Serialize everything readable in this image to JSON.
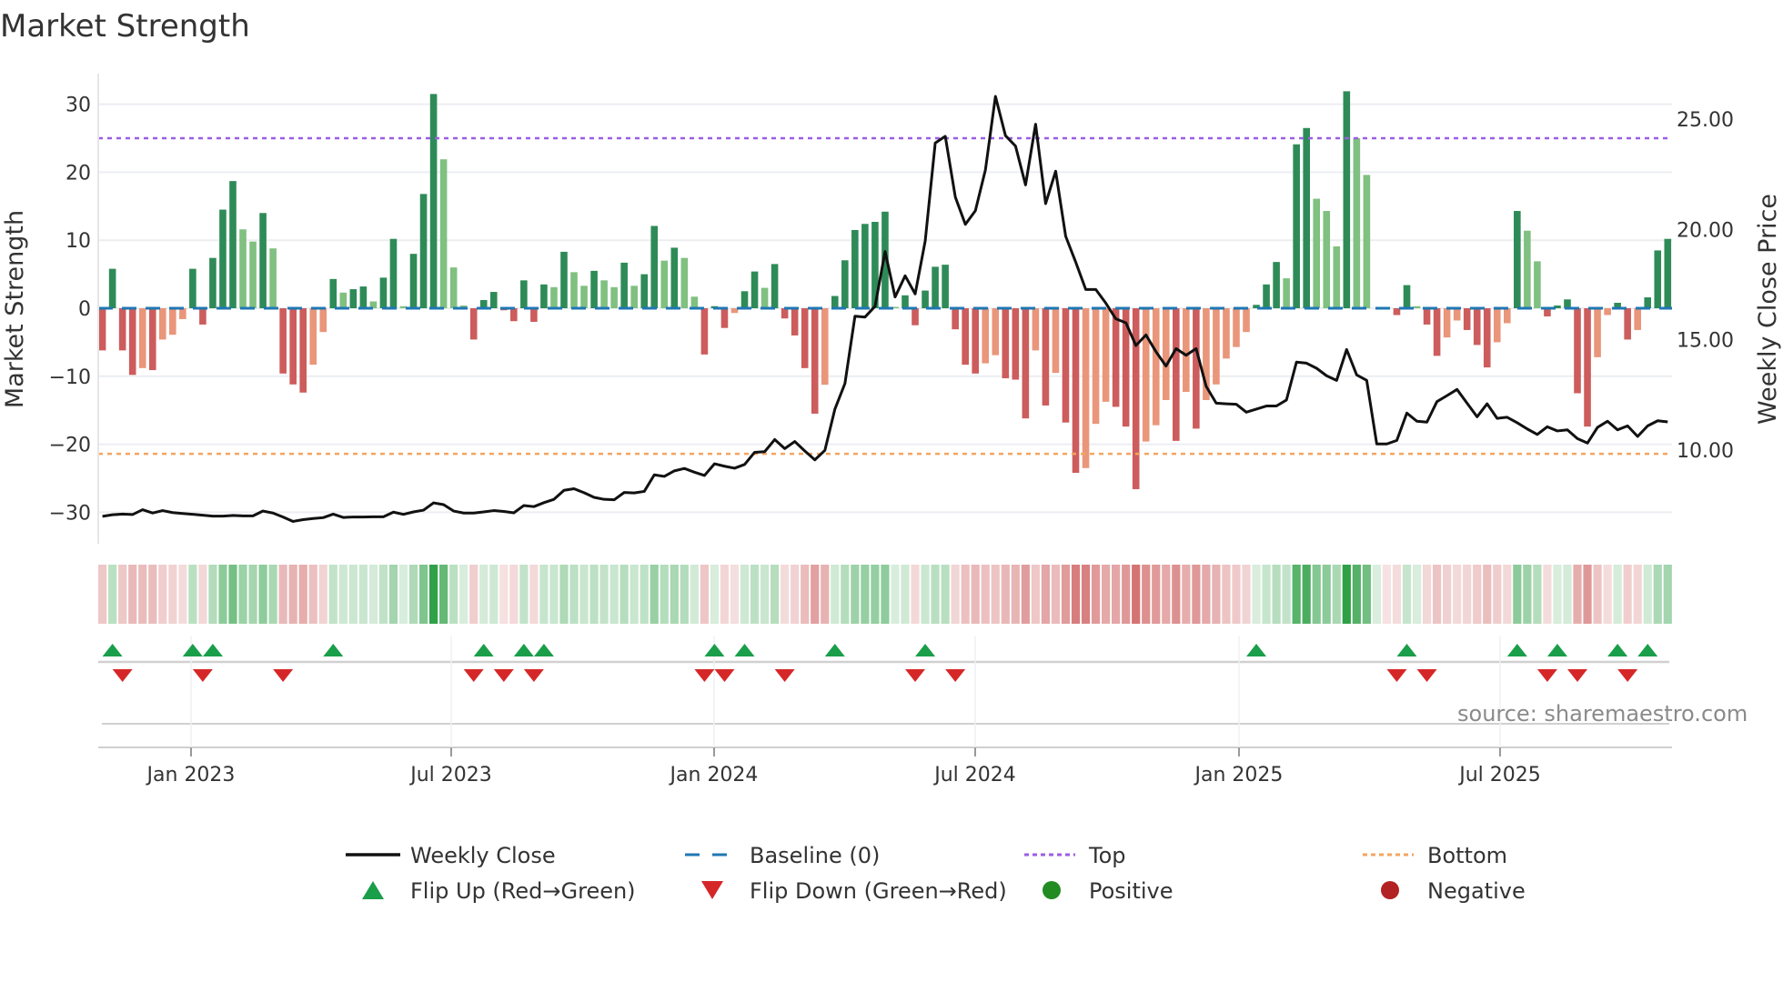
{
  "chart_data": {
    "type": "bar",
    "title": "Market Strength",
    "ylabel": "Market Strength",
    "y2label": "Weekly Close Price",
    "ylim": [
      -34,
      33
    ],
    "y2lim": [
      5.58,
      26.87
    ],
    "yticks": [
      30,
      20,
      10,
      0,
      -10,
      -20,
      -30
    ],
    "yticklabels": [
      "30",
      "20",
      "10",
      "0",
      "−10",
      "−20",
      "−30"
    ],
    "y2ticks": [
      25,
      20,
      15,
      10
    ],
    "y2ticklabels": [
      "25.00",
      "20.00",
      "15.00",
      "10.00"
    ],
    "xticks": [
      {
        "label": "Jan 2023",
        "week": 8.83
      },
      {
        "label": "Jul 2023",
        "week": 34.76
      },
      {
        "label": "Jan 2024",
        "week": 60.96
      },
      {
        "label": "Jul 2024",
        "week": 86.98
      },
      {
        "label": "Jan 2025",
        "week": 113.27
      },
      {
        "label": "Jul 2025",
        "week": 139.29
      }
    ],
    "grid": true,
    "legend_placement": "bottom",
    "top_level": 25,
    "bottom_level": -21.4,
    "baseline": 0,
    "strength": [
      -6.2,
      5.8,
      -6.2,
      -9.8,
      -8.8,
      -9.1,
      -4.6,
      -3.9,
      -1.6,
      5.8,
      -2.4,
      7.4,
      14.5,
      18.7,
      11.6,
      9.8,
      14.0,
      8.8,
      -9.6,
      -11.2,
      -12.4,
      -8.3,
      -3.5,
      4.3,
      2.3,
      2.8,
      3.2,
      1.0,
      4.5,
      10.2,
      0.3,
      8.0,
      16.8,
      31.5,
      21.9,
      6.0,
      0.4,
      -4.6,
      1.2,
      2.4,
      -0.3,
      -1.9,
      4.1,
      -2.0,
      3.5,
      3.1,
      8.3,
      5.3,
      3.3,
      5.5,
      4.1,
      3.1,
      6.7,
      3.3,
      5.0,
      12.1,
      7.0,
      8.9,
      7.4,
      1.7,
      -6.8,
      0.3,
      -2.9,
      -0.7,
      2.5,
      5.4,
      3.0,
      6.5,
      -1.5,
      -4.0,
      -8.8,
      -15.5,
      -11.25,
      1.8,
      7.05,
      11.5,
      12.4,
      12.7,
      14.2,
      0.2,
      1.9,
      -2.5,
      2.6,
      6.1,
      6.4,
      -3.1,
      -8.3,
      -9.6,
      -8.1,
      -6.9,
      -10.3,
      -10.5,
      -16.2,
      -6.2,
      -14.3,
      -9.5,
      -16.8,
      -24.2,
      -23.5,
      -17.0,
      -13.75,
      -14.5,
      -17.4,
      -26.6,
      -19.6,
      -17.2,
      -13.5,
      -19.5,
      -12.3,
      -17.7,
      -13.5,
      -11.2,
      -7.4,
      -5.7,
      -3.5,
      0.5,
      3.5,
      6.8,
      4.4,
      24.1,
      26.5,
      16.1,
      14.3,
      9.1,
      31.9,
      25.0,
      19.6,
      0,
      0,
      -1.0,
      3.4,
      0.3,
      -2.4,
      -7.0,
      -4.3,
      -1.8,
      -3.2,
      -5.4,
      -8.7,
      -5.0,
      -2.2,
      14.3,
      11.4,
      6.9,
      -1.2,
      0.4,
      1.3,
      -12.5,
      -17.4,
      -7.2,
      -1.0,
      0.8,
      -4.6,
      -3.2,
      1.6,
      8.5,
      10.2
    ],
    "weekly_close": [
      7.0,
      7.07,
      7.1,
      7.08,
      7.3,
      7.15,
      7.26,
      7.17,
      7.13,
      7.09,
      7.05,
      7.01,
      7.01,
      7.04,
      7.02,
      7.02,
      7.24,
      7.15,
      6.97,
      6.77,
      6.85,
      6.9,
      6.94,
      7.1,
      6.95,
      6.97,
      6.97,
      6.98,
      6.98,
      7.19,
      7.09,
      7.2,
      7.28,
      7.61,
      7.53,
      7.24,
      7.15,
      7.15,
      7.2,
      7.26,
      7.22,
      7.16,
      7.49,
      7.44,
      7.62,
      7.77,
      8.18,
      8.25,
      8.07,
      7.86,
      7.77,
      7.75,
      8.08,
      8.06,
      8.13,
      8.88,
      8.81,
      9.06,
      9.17,
      9.0,
      8.85,
      9.38,
      9.27,
      9.18,
      9.35,
      9.9,
      9.93,
      10.48,
      10.07,
      10.39,
      9.96,
      9.56,
      9.99,
      11.86,
      13.02,
      16.07,
      16.03,
      16.52,
      19.0,
      16.94,
      17.9,
      17.08,
      19.48,
      23.92,
      24.22,
      21.47,
      20.23,
      20.85,
      22.7,
      26.03,
      24.25,
      23.78,
      22.02,
      24.77,
      21.17,
      22.64,
      19.69,
      18.52,
      17.28,
      17.28,
      16.66,
      15.95,
      15.77,
      14.74,
      15.22,
      14.46,
      13.81,
      14.6,
      14.3,
      14.6,
      12.89,
      12.13,
      12.1,
      12.08,
      11.72,
      11.86,
      12.0,
      12.0,
      12.27,
      13.99,
      13.94,
      13.71,
      13.37,
      13.16,
      14.56,
      13.41,
      13.16,
      10.28,
      10.28,
      10.44,
      11.68,
      11.31,
      11.27,
      12.2,
      12.47,
      12.75,
      12.13,
      11.51,
      12.1,
      11.44,
      11.49,
      11.24,
      10.96,
      10.71,
      11.06,
      10.87,
      10.92,
      10.52,
      10.32,
      11.03,
      11.31,
      10.92,
      11.1,
      10.62,
      11.1,
      11.33,
      11.28
    ],
    "flip_up_weeks": [
      1,
      9,
      11,
      23,
      38,
      42,
      44,
      61,
      64,
      73,
      82,
      115,
      130,
      141,
      145,
      151,
      154
    ],
    "flip_down_weeks": [
      2,
      10,
      18,
      37,
      40,
      43,
      60,
      62,
      68,
      81,
      85,
      129,
      132,
      144,
      147,
      152
    ],
    "legend": [
      {
        "key": "weekly_close",
        "label": "Weekly Close"
      },
      {
        "key": "baseline",
        "label": "Baseline (0)"
      },
      {
        "key": "top",
        "label": "Top"
      },
      {
        "key": "bottom",
        "label": "Bottom"
      },
      {
        "key": "flip_up",
        "label": "Flip Up (Red→Green)"
      },
      {
        "key": "flip_down",
        "label": "Flip Down (Green→Red)"
      },
      {
        "key": "positive",
        "label": "Positive"
      },
      {
        "key": "negative",
        "label": "Negative"
      }
    ],
    "source": "source: sharemaestro.com"
  },
  "colors": {
    "pos_strong": "#2e8b57",
    "pos_weak": "#80c080",
    "neg_strong": "#cd5c5c",
    "neg_weak": "#e9967a",
    "close": "#111111",
    "baseline": "#1f77b4",
    "top": "#9b5de5",
    "bottom": "#f4a460",
    "flip_up": "#1a9e4a",
    "flip_down": "#d62728",
    "positive": "#228b22",
    "negative": "#b22222"
  }
}
